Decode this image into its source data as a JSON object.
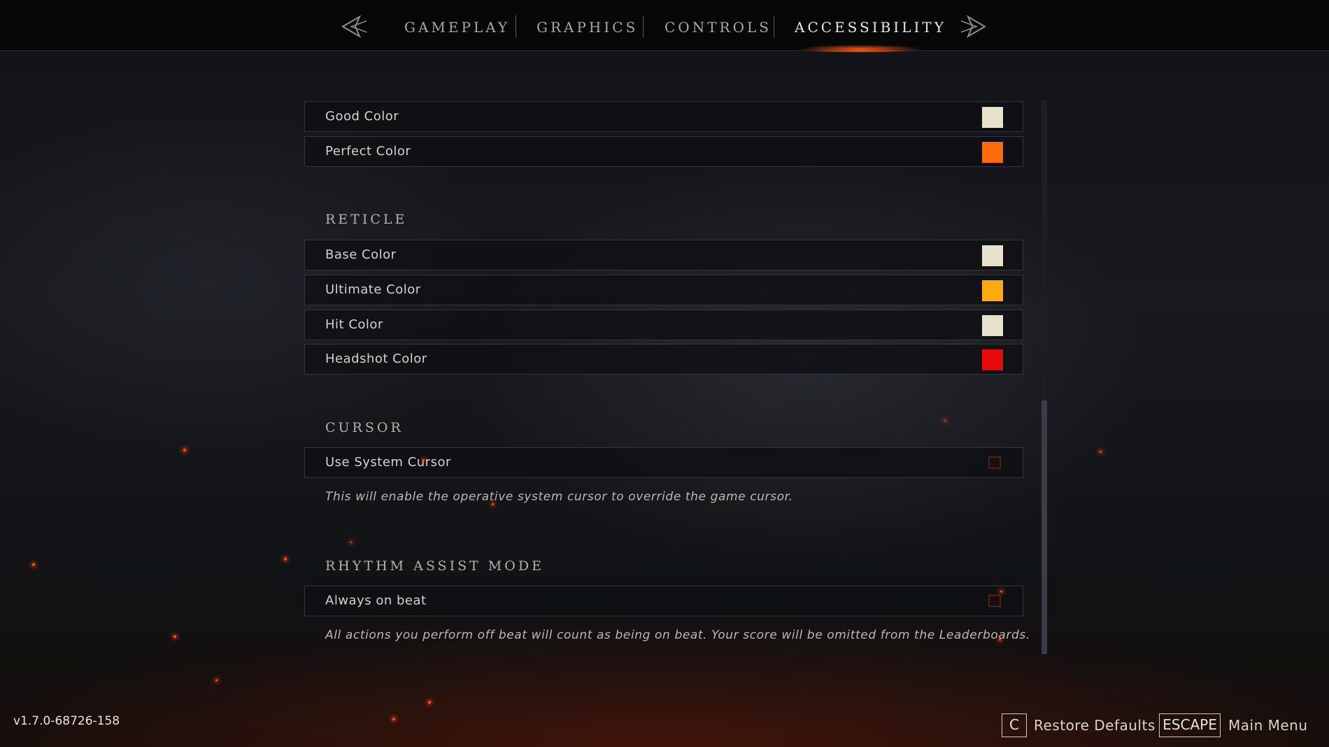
{
  "tabs": [
    {
      "label": "GAMEPLAY"
    },
    {
      "label": "GRAPHICS"
    },
    {
      "label": "CONTROLS"
    },
    {
      "label": "ACCESSIBILITY",
      "active": true
    }
  ],
  "icons": {
    "prev": "chevron-left-icon",
    "next": "chevron-right-icon"
  },
  "rows_top": [
    {
      "label": "Good Color",
      "color": "#e6e2cc"
    },
    {
      "label": "Perfect Color",
      "color": "#ff6a0a"
    }
  ],
  "reticle": {
    "title": "RETICLE",
    "rows": [
      {
        "label": "Base Color",
        "color": "#e6e2cc"
      },
      {
        "label": "Ultimate Color",
        "color": "#ffab0f"
      },
      {
        "label": "Hit Color",
        "color": "#e6e2cc"
      },
      {
        "label": "Headshot Color",
        "color": "#e60a0a"
      }
    ]
  },
  "cursor": {
    "title": "CURSOR",
    "label": "Use System Cursor",
    "checked": false,
    "description": "This will enable the operative system cursor to override the game cursor."
  },
  "rhythm": {
    "title": "RHYTHM ASSIST MODE",
    "label": "Always on beat",
    "checked": false,
    "description": "All actions you perform off beat will count as being on beat. Your score will be omitted from the Leaderboards."
  },
  "footer": {
    "version": "v1.7.0-68726-158",
    "restore_key": "C",
    "restore_label": "Restore Defaults",
    "menu_key": "ESCAPE",
    "menu_label": "Main Menu"
  },
  "colors": {
    "accent": "#ff5a14"
  }
}
